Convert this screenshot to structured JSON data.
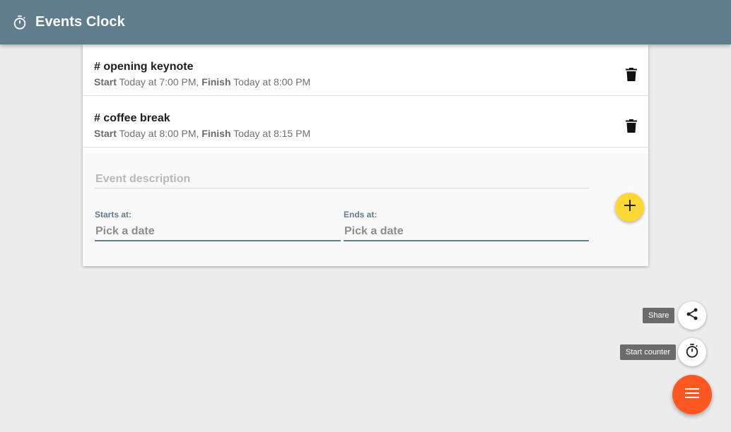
{
  "app": {
    "title": "Events Clock",
    "icon": "stopwatch-icon",
    "header_color": "#607d8b"
  },
  "events": [
    {
      "title": "# opening keynote",
      "start_label": "Start",
      "start_value": "Today at 7:00 PM,",
      "finish_label": "Finish",
      "finish_value": "Today at 8:00 PM",
      "delete_icon": "trash-icon"
    },
    {
      "title": "# coffee break",
      "start_label": "Start",
      "start_value": "Today at 8:00 PM,",
      "finish_label": "Finish",
      "finish_value": "Today at 8:15 PM",
      "delete_icon": "trash-icon"
    }
  ],
  "form": {
    "description_placeholder": "Event description",
    "description_value": "",
    "starts_label": "Starts at:",
    "starts_placeholder": "Pick a date",
    "ends_label": "Ends at:",
    "ends_placeholder": "Pick a date",
    "add_icon": "plus-icon",
    "add_button_color": "#fdd835"
  },
  "speed_dial": {
    "share_tooltip": "Share",
    "share_icon": "share-icon",
    "counter_tooltip": "Start counter",
    "counter_icon": "stopwatch-icon",
    "menu_icon": "menu-icon",
    "menu_button_color": "#ff5722"
  }
}
